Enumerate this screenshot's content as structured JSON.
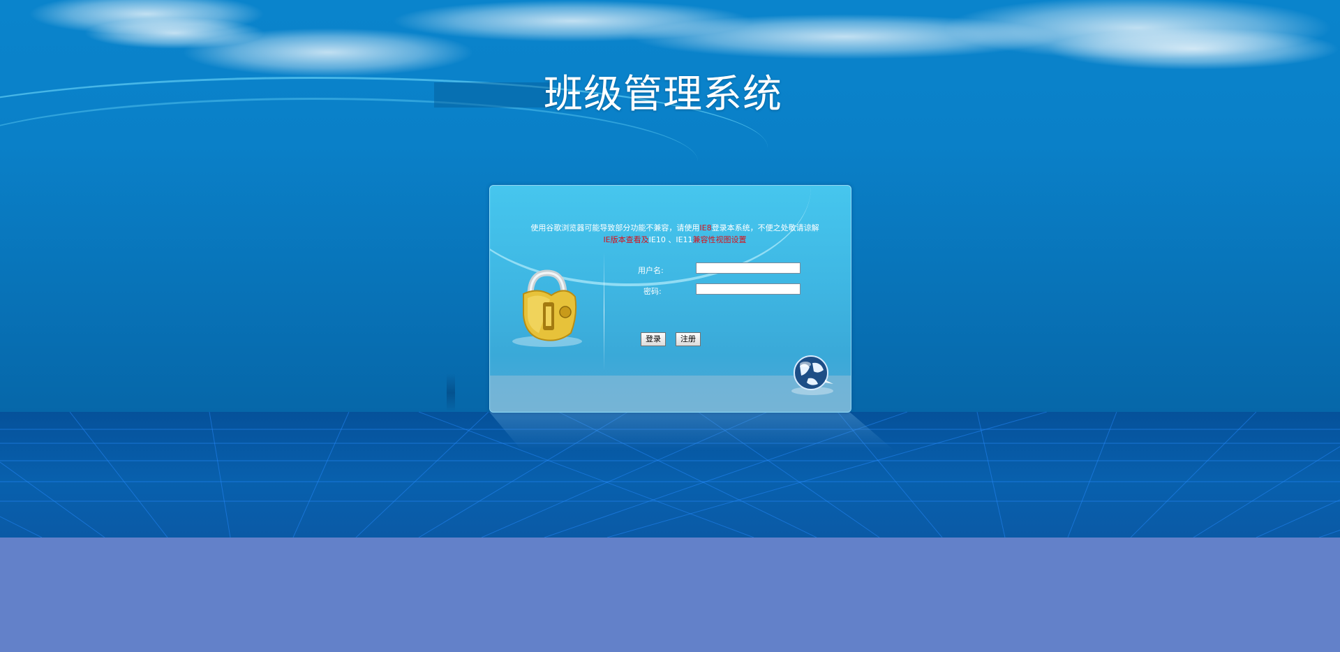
{
  "app": {
    "title": "班级管理系统"
  },
  "notice": {
    "line1_a": "使用谷歌浏览器可能导致部分功能不兼容，请使用",
    "line1_ie": "IE8",
    "line1_b": "登录本系统，不便之处敬请谅解",
    "line2_a": "IE版本查看及",
    "line2_b": "IE10",
    "line2_sep": " 、",
    "line2_c": "IE11",
    "line2_d": "兼容性视图设置"
  },
  "form": {
    "username_label": "用户名:",
    "username_value": "",
    "password_label": "密码:",
    "password_value": ""
  },
  "buttons": {
    "login": "登录",
    "register": "注册"
  },
  "icons": {
    "lock": "lock-icon",
    "globe": "globe-icon"
  },
  "colors": {
    "sky": "#0a84cc",
    "floor": "#05519a",
    "page_bottom": "#6381c9",
    "notice_highlight": "#d8101a"
  }
}
